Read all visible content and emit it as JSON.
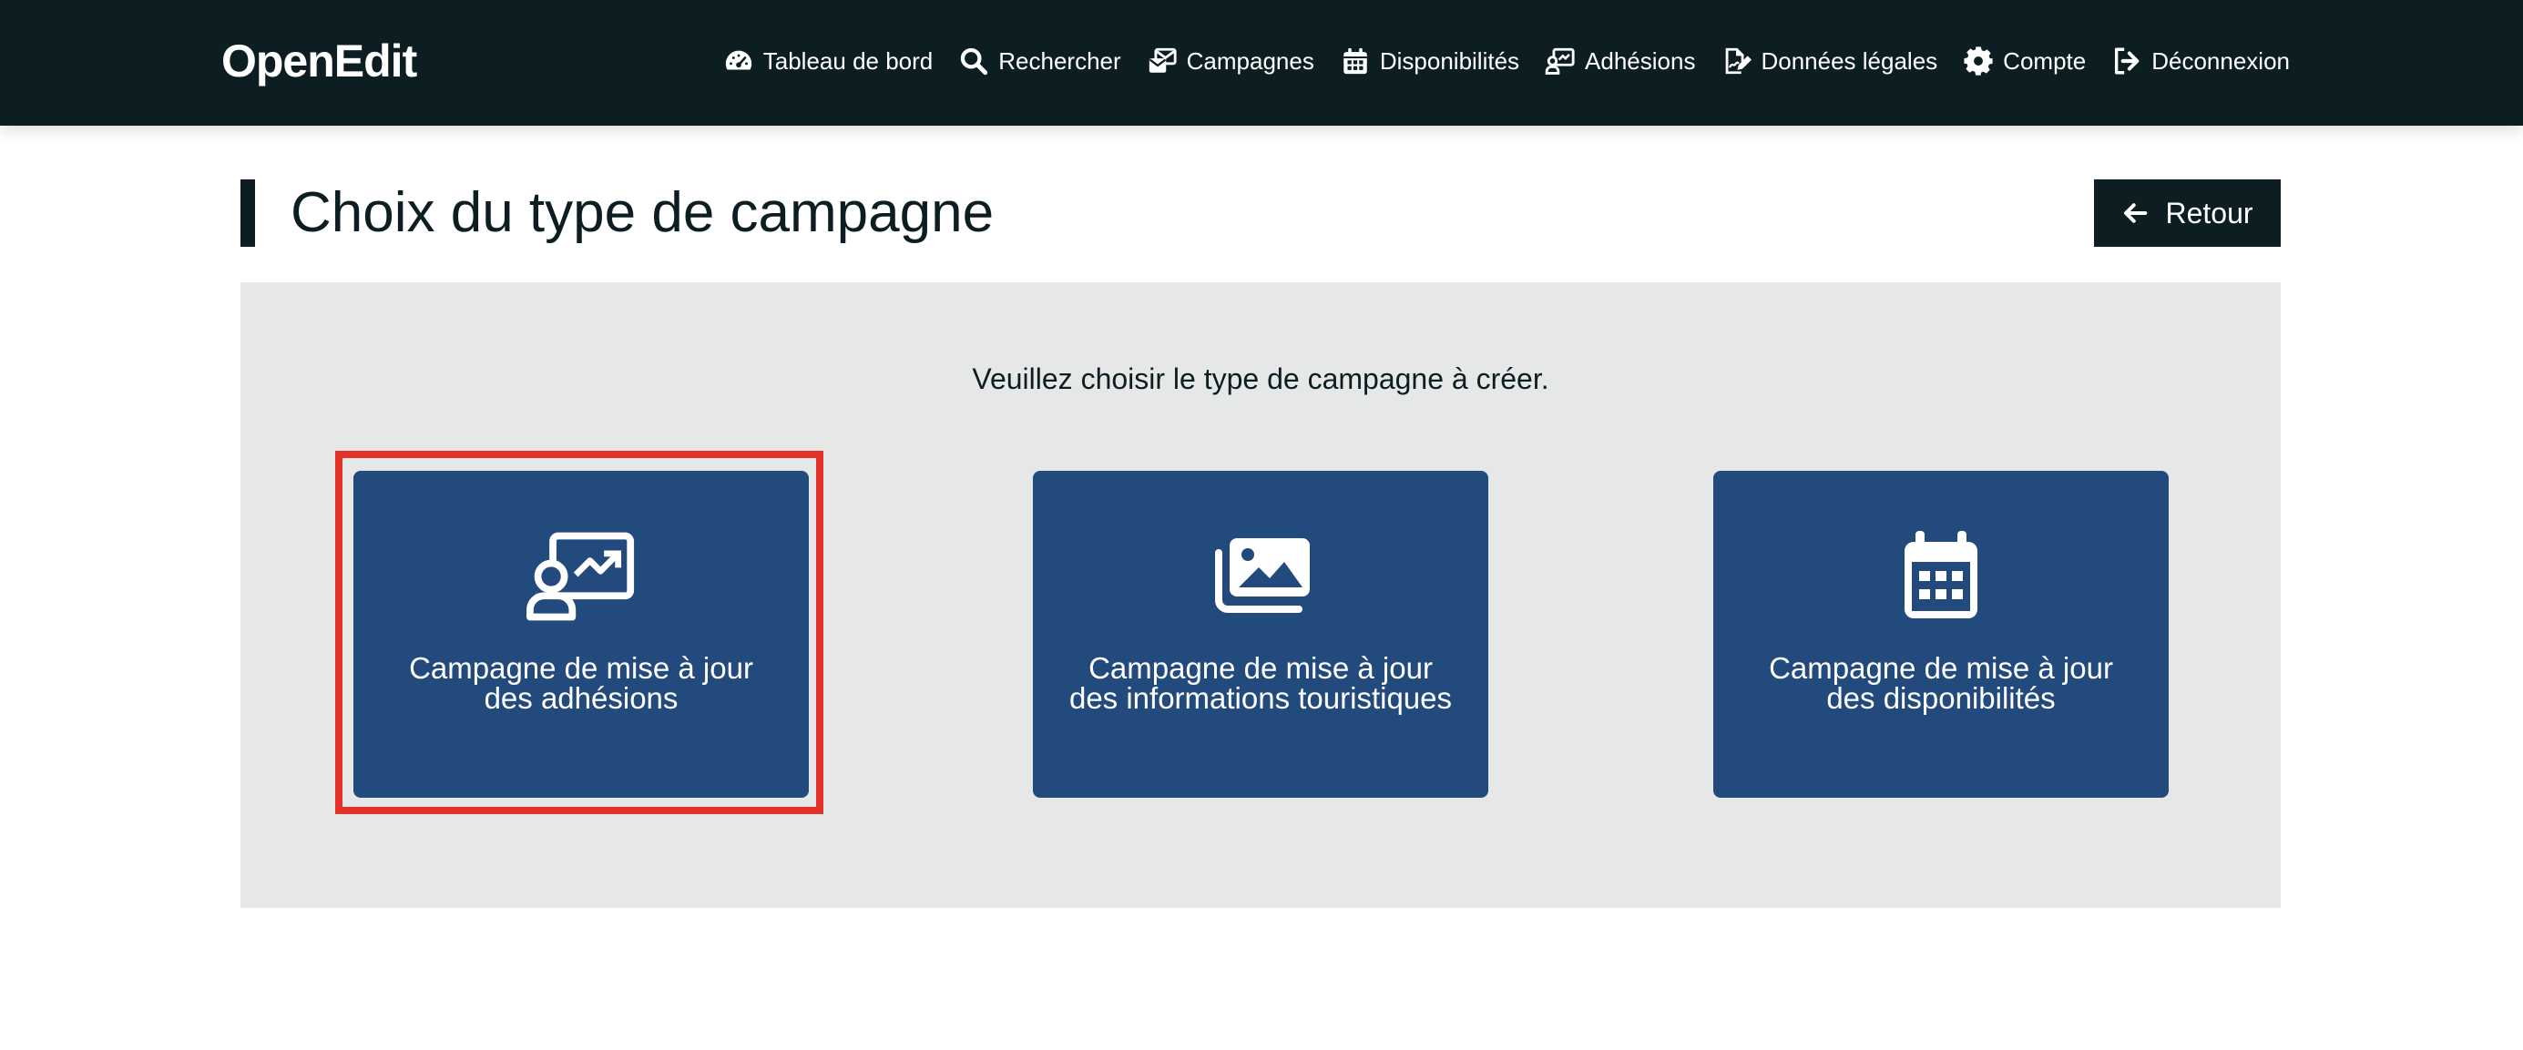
{
  "brand": {
    "name": "OpenEdit"
  },
  "nav": {
    "items": [
      {
        "label": "Tableau de bord",
        "icon": "gauge-icon"
      },
      {
        "label": "Rechercher",
        "icon": "search-icon"
      },
      {
        "label": "Campagnes",
        "icon": "campaign-icon"
      },
      {
        "label": "Disponibilités",
        "icon": "calendar-icon"
      },
      {
        "label": "Adhésions",
        "icon": "user-chart-icon"
      },
      {
        "label": "Données légales",
        "icon": "file-signature-icon"
      },
      {
        "label": "Compte",
        "icon": "gear-icon"
      },
      {
        "label": "Déconnexion",
        "icon": "logout-icon"
      }
    ]
  },
  "page": {
    "title": "Choix du type de campagne",
    "back_label": "Retour"
  },
  "panel": {
    "instruction": "Veuillez choisir le type de campagne à créer.",
    "cards": [
      {
        "line1": "Campagne de mise à jour",
        "line2": "des adhésions",
        "icon": "user-chart-icon"
      },
      {
        "line1": "Campagne de mise à jour",
        "line2": "des informations touristiques",
        "icon": "images-icon"
      },
      {
        "line1": "Campagne de mise à jour",
        "line2": "des disponibilités",
        "icon": "calendar-icon"
      }
    ]
  },
  "colors": {
    "navbar": "#0d1e22",
    "card": "#224a7d",
    "panel": "#e6e8e7",
    "highlight": "#e4312a"
  }
}
